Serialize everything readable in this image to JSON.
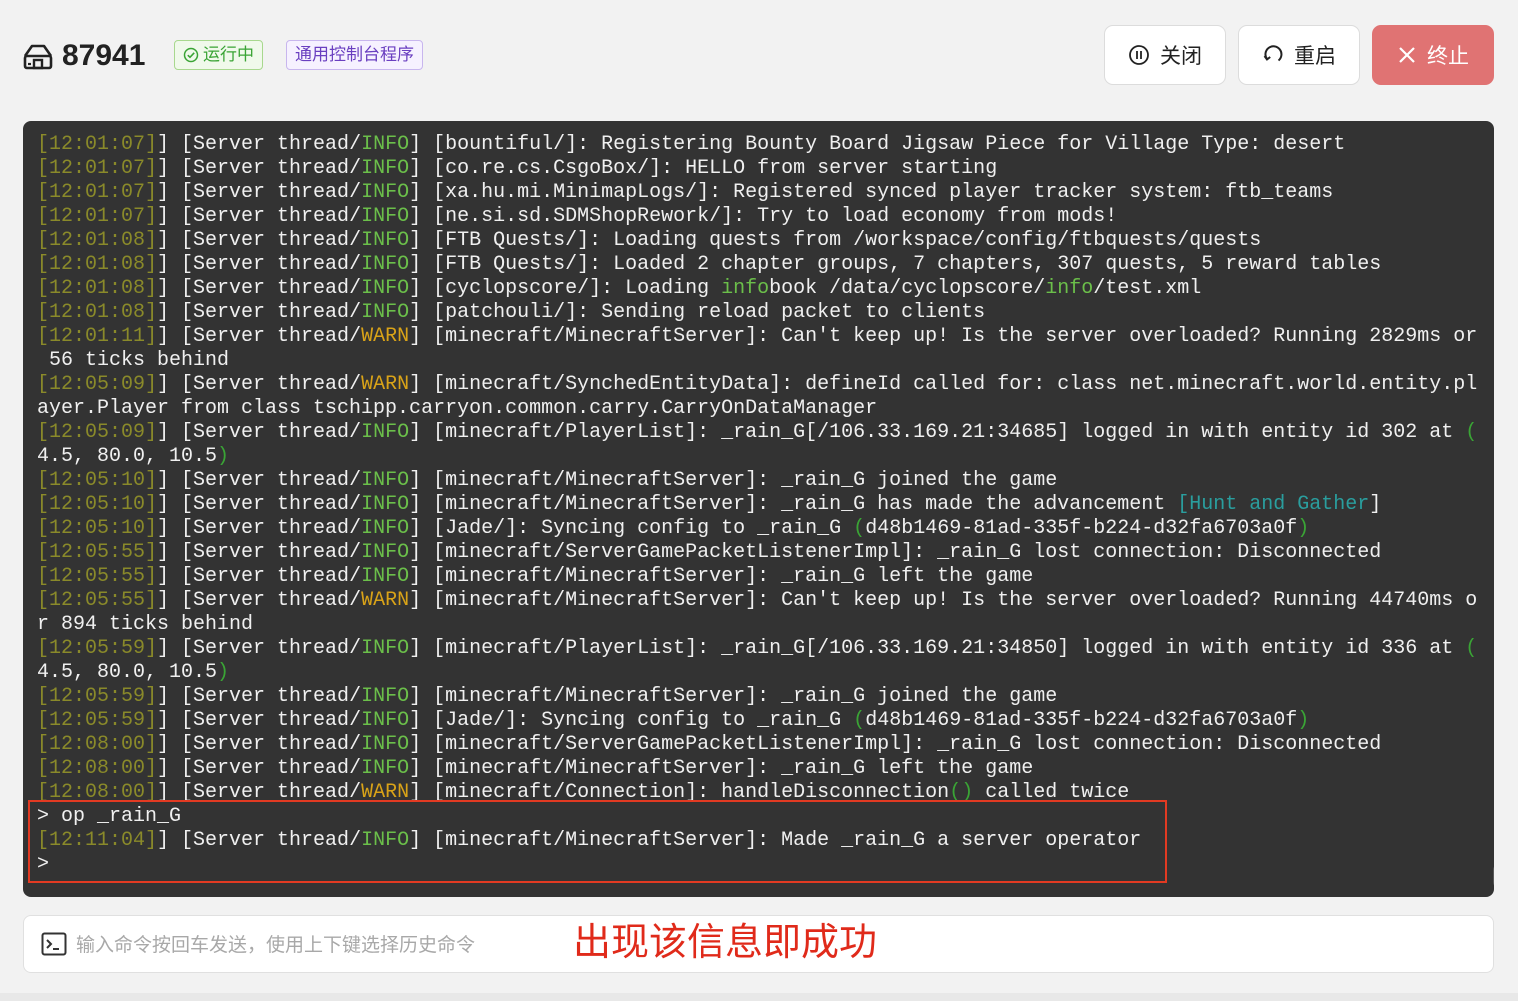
{
  "header": {
    "server_id": "87941",
    "status_label": "运行中",
    "type_label": "通用控制台程序",
    "buttons": {
      "close": "关闭",
      "restart": "重启",
      "stop": "终止"
    }
  },
  "colors": {
    "running_green": "#3aa435",
    "stop_red": "#e07373",
    "annotation_red": "#e02a1a",
    "console_bg": "#333333"
  },
  "console": {
    "lines": [
      [
        [
          "ts",
          "[12:01:07]"
        ],
        [
          "",
          "] [Server thread/"
        ],
        [
          "info",
          "INFO"
        ],
        [
          "",
          "] [bountiful/]: Registering Bounty Board Jigsaw Piece for Village Type: desert"
        ]
      ],
      [
        [
          "ts",
          "[12:01:07]"
        ],
        [
          "",
          "] [Server thread/"
        ],
        [
          "info",
          "INFO"
        ],
        [
          "",
          "] [co.re.cs.CsgoBox/]: HELLO from server starting"
        ]
      ],
      [
        [
          "ts",
          "[12:01:07]"
        ],
        [
          "",
          "] [Server thread/"
        ],
        [
          "info",
          "INFO"
        ],
        [
          "",
          "] [xa.hu.mi.MinimapLogs/]: Registered synced player tracker system: ftb_teams"
        ]
      ],
      [
        [
          "ts",
          "[12:01:07]"
        ],
        [
          "",
          "] [Server thread/"
        ],
        [
          "info",
          "INFO"
        ],
        [
          "",
          "] [ne.si.sd.SDMShopRework/]: Try to load economy from mods!"
        ]
      ],
      [
        [
          "ts",
          "[12:01:08]"
        ],
        [
          "",
          "] [Server thread/"
        ],
        [
          "info",
          "INFO"
        ],
        [
          "",
          "] [FTB Quests/]: Loading quests from /workspace/config/ftbquests/quests"
        ]
      ],
      [
        [
          "ts",
          "[12:01:08]"
        ],
        [
          "",
          "] [Server thread/"
        ],
        [
          "info",
          "INFO"
        ],
        [
          "",
          "] [FTB Quests/]: Loaded 2 chapter groups, 7 chapters, 307 quests, 5 reward tables"
        ]
      ],
      [
        [
          "ts",
          "[12:01:08]"
        ],
        [
          "",
          "] [Server thread/"
        ],
        [
          "info",
          "INFO"
        ],
        [
          "",
          "] [cyclopscore/]: Loading "
        ],
        [
          "info",
          "info"
        ],
        [
          "",
          "book /data/cyclopscore/"
        ],
        [
          "info",
          "info"
        ],
        [
          "",
          "/test.xml"
        ]
      ],
      [
        [
          "ts",
          "[12:01:08]"
        ],
        [
          "",
          "] [Server thread/"
        ],
        [
          "info",
          "INFO"
        ],
        [
          "",
          "] [patchouli/]: Sending reload packet to clients"
        ]
      ],
      [
        [
          "ts",
          "[12:01:11]"
        ],
        [
          "",
          "] [Server thread/"
        ],
        [
          "warn",
          "WARN"
        ],
        [
          "",
          "] [minecraft/MinecraftServer]: Can't keep up! Is the server overloaded? Running 2829ms or"
        ]
      ],
      [
        [
          "",
          ""
        ],
        [
          "",
          ""
        ],
        [
          "",
          ""
        ],
        [
          "",
          " 56 ticks behind"
        ]
      ],
      [
        [
          "ts",
          "[12:05:09]"
        ],
        [
          "",
          "] [Server thread/"
        ],
        [
          "warn",
          "WARN"
        ],
        [
          "",
          "] [minecraft/SynchedEntityData]: defineId called for: class net.minecraft.world.entity.pl"
        ]
      ],
      [
        [
          "",
          ""
        ],
        [
          "",
          ""
        ],
        [
          "",
          ""
        ],
        [
          "",
          "ayer.Player from class tschipp.carryon.common.carry.CarryOnDataManager"
        ]
      ],
      [
        [
          "ts",
          "[12:05:09]"
        ],
        [
          "",
          "] [Server thread/"
        ],
        [
          "info",
          "INFO"
        ],
        [
          "",
          "] [minecraft/PlayerList]: _rain_G[/106.33.169.21:34685] logged in with entity id 302 at "
        ],
        [
          "paren",
          "("
        ]
      ],
      [
        [
          "",
          ""
        ],
        [
          "",
          ""
        ],
        [
          "",
          ""
        ],
        [
          "",
          "4.5, 80.0, 10.5"
        ],
        [
          "paren",
          ")"
        ]
      ],
      [
        [
          "ts",
          "[12:05:10]"
        ],
        [
          "",
          "] [Server thread/"
        ],
        [
          "info",
          "INFO"
        ],
        [
          "",
          "] [minecraft/MinecraftServer]: _rain_G joined the game"
        ]
      ],
      [
        [
          "ts",
          "[12:05:10]"
        ],
        [
          "",
          "] [Server thread/"
        ],
        [
          "info",
          "INFO"
        ],
        [
          "",
          "] [minecraft/MinecraftServer]: _rain_G has made the advancement "
        ],
        [
          "link",
          "["
        ],
        [
          "link",
          "Hunt and Gather"
        ],
        [
          "",
          "]"
        ]
      ],
      [
        [
          "ts",
          "[12:05:10]"
        ],
        [
          "",
          "] [Server thread/"
        ],
        [
          "info",
          "INFO"
        ],
        [
          "",
          "] [Jade/]: Syncing config to _rain_G "
        ],
        [
          "paren",
          "("
        ],
        [
          "",
          "d48b1469-81ad-335f-b224-d32fa6703a0f"
        ],
        [
          "paren",
          ")"
        ]
      ],
      [
        [
          "ts",
          "[12:05:55]"
        ],
        [
          "",
          "] [Server thread/"
        ],
        [
          "info",
          "INFO"
        ],
        [
          "",
          "] [minecraft/ServerGamePacketListenerImpl]: _rain_G lost connection: Disconnected"
        ]
      ],
      [
        [
          "ts",
          "[12:05:55]"
        ],
        [
          "",
          "] [Server thread/"
        ],
        [
          "info",
          "INFO"
        ],
        [
          "",
          "] [minecraft/MinecraftServer]: _rain_G left the game"
        ]
      ],
      [
        [
          "ts",
          "[12:05:55]"
        ],
        [
          "",
          "] [Server thread/"
        ],
        [
          "warn",
          "WARN"
        ],
        [
          "",
          "] [minecraft/MinecraftServer]: Can't keep up! Is the server overloaded? Running 44740ms o"
        ]
      ],
      [
        [
          "",
          ""
        ],
        [
          "",
          ""
        ],
        [
          "",
          ""
        ],
        [
          "",
          "r 894 ticks behind"
        ]
      ],
      [
        [
          "ts",
          "[12:05:59]"
        ],
        [
          "",
          "] [Server thread/"
        ],
        [
          "info",
          "INFO"
        ],
        [
          "",
          "] [minecraft/PlayerList]: _rain_G[/106.33.169.21:34850] logged in with entity id 336 at "
        ],
        [
          "paren",
          "("
        ]
      ],
      [
        [
          "",
          ""
        ],
        [
          "",
          ""
        ],
        [
          "",
          ""
        ],
        [
          "",
          "4.5, 80.0, 10.5"
        ],
        [
          "paren",
          ")"
        ]
      ],
      [
        [
          "ts",
          "[12:05:59]"
        ],
        [
          "",
          "] [Server thread/"
        ],
        [
          "info",
          "INFO"
        ],
        [
          "",
          "] [minecraft/MinecraftServer]: _rain_G joined the game"
        ]
      ],
      [
        [
          "ts",
          "[12:05:59]"
        ],
        [
          "",
          "] [Server thread/"
        ],
        [
          "info",
          "INFO"
        ],
        [
          "",
          "] [Jade/]: Syncing config to _rain_G "
        ],
        [
          "paren",
          "("
        ],
        [
          "",
          "d48b1469-81ad-335f-b224-d32fa6703a0f"
        ],
        [
          "paren",
          ")"
        ]
      ],
      [
        [
          "ts",
          "[12:08:00]"
        ],
        [
          "",
          "] [Server thread/"
        ],
        [
          "info",
          "INFO"
        ],
        [
          "",
          "] [minecraft/ServerGamePacketListenerImpl]: _rain_G lost connection: Disconnected"
        ]
      ],
      [
        [
          "ts",
          "[12:08:00]"
        ],
        [
          "",
          "] [Server thread/"
        ],
        [
          "info",
          "INFO"
        ],
        [
          "",
          "] [minecraft/MinecraftServer]: _rain_G left the game"
        ]
      ],
      [
        [
          "ts",
          "[12:08:00]"
        ],
        [
          "",
          "] [Server thread/"
        ],
        [
          "warn",
          "WARN"
        ],
        [
          "",
          "] [minecraft/Connection]: handleDisconnection"
        ],
        [
          "paren",
          "()"
        ],
        [
          "",
          " called twice"
        ]
      ],
      [
        [
          "",
          ""
        ],
        [
          "",
          ""
        ],
        [
          "",
          ""
        ],
        [
          "",
          "> op _rain_G"
        ]
      ],
      [
        [
          "ts",
          "[12:11:04]"
        ],
        [
          "",
          "] [Server thread/"
        ],
        [
          "info",
          "INFO"
        ],
        [
          "",
          "] [minecraft/MinecraftServer]: Made _rain_G a server operator"
        ]
      ],
      [
        [
          "",
          ""
        ],
        [
          "",
          ""
        ],
        [
          "",
          ""
        ],
        [
          "",
          ">"
        ]
      ]
    ]
  },
  "command": {
    "placeholder": "输入命令按回车发送，使用上下键选择历史命令",
    "value": ""
  },
  "annotation": {
    "text": "出现该信息即成功"
  },
  "icons": {
    "server": "server-icon",
    "running": "check-circle-icon",
    "close": "pause-circle-icon",
    "restart": "refresh-icon",
    "stop": "close-x-icon",
    "terminal": "terminal-icon"
  }
}
